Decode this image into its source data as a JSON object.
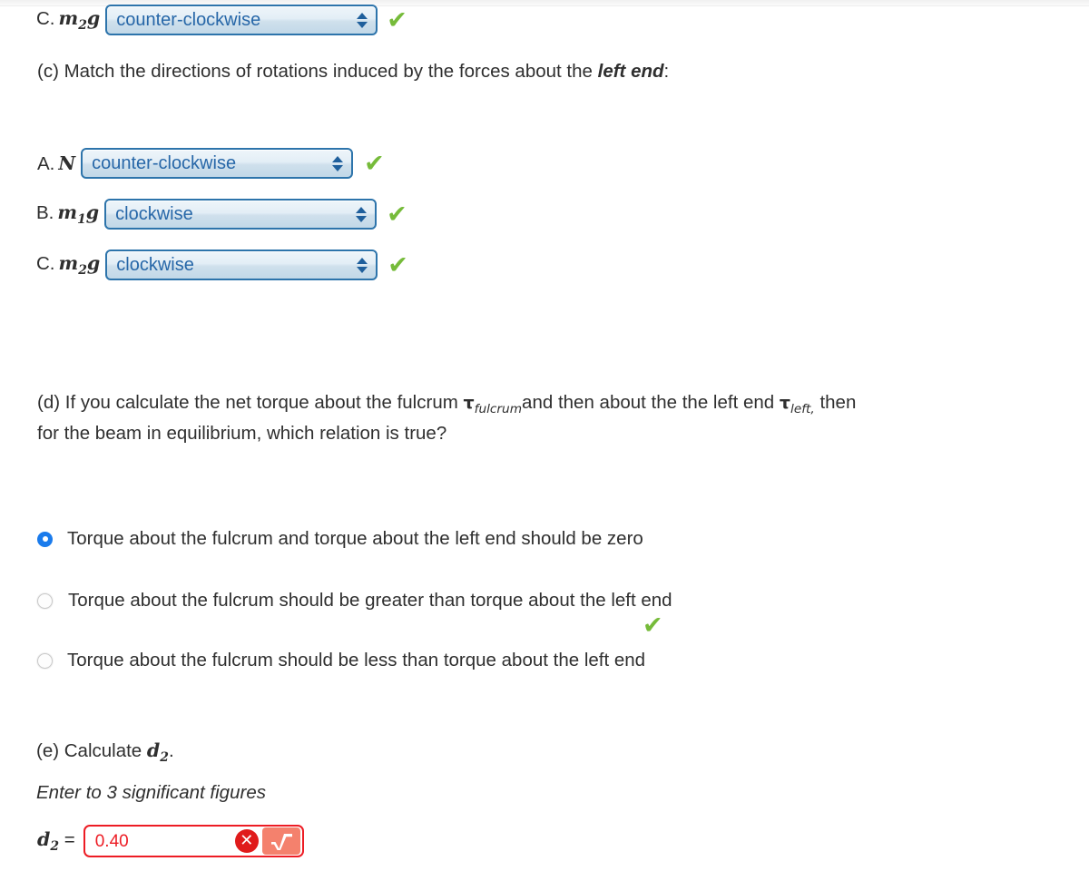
{
  "sections": {
    "part_b_last_row": {
      "label_prefix": "C.",
      "label_var": "m",
      "label_sub": "2",
      "label_suffix": "g",
      "selected": "counter-clockwise",
      "options": [
        "clockwise",
        "counter-clockwise"
      ],
      "status": "correct",
      "check_glyph": "✔"
    },
    "part_c": {
      "prompt_before": "(c) Match the directions of rotations induced by the forces about the ",
      "prompt_bold": "left end",
      "prompt_after": ":",
      "rows": [
        {
          "letter": "A.",
          "var": "N",
          "sub": "",
          "suffix": "",
          "selected": "counter-clockwise",
          "options": [
            "clockwise",
            "counter-clockwise"
          ],
          "status": "correct",
          "check_glyph": "✔"
        },
        {
          "letter": "B.",
          "var": "m",
          "sub": "1",
          "suffix": "g",
          "selected": "clockwise",
          "options": [
            "clockwise",
            "counter-clockwise"
          ],
          "status": "correct",
          "check_glyph": "✔"
        },
        {
          "letter": "C.",
          "var": "m",
          "sub": "2",
          "suffix": "g",
          "selected": "clockwise",
          "options": [
            "clockwise",
            "counter-clockwise"
          ],
          "status": "correct",
          "check_glyph": "✔"
        }
      ]
    },
    "part_d": {
      "line1_a": "(d) If you calculate the net torque about the fulcrum ",
      "tau1_symbol": "τ",
      "tau1_sub": "fulcrum",
      "line1_b": "and then about the the left end ",
      "tau2_symbol": "τ",
      "tau2_sub": "left,",
      "line1_c": " then",
      "line2": "for the beam in equilibrium, which relation is true?",
      "options": [
        {
          "label": "Torque about the fulcrum and torque about the left end should be zero",
          "selected": true
        },
        {
          "label": "Torque about the fulcrum should be greater than torque about the left end",
          "selected": false
        },
        {
          "label": "Torque about the fulcrum should be less than torque about the left end",
          "selected": false
        }
      ],
      "feedback_check_glyph": "✔",
      "feedback_status": "correct"
    },
    "part_e": {
      "prompt_prefix": "(e) Calculate ",
      "prompt_var": "d",
      "prompt_sub": "2",
      "prompt_suffix": ".",
      "hint": "Enter to 3 significant figures",
      "answer_var": "d",
      "answer_sub": "2",
      "answer_eq": "=",
      "answer_value": "0.40",
      "answer_placeholder": "",
      "status": "incorrect",
      "x_glyph": "✕",
      "sqrt_label": "√"
    }
  },
  "colors": {
    "correct_green": "#76bb3a",
    "incorrect_red": "#ed1c24",
    "select_blue": "#2767a8",
    "select_border": "#2d74ab",
    "radio_selected": "#1a7bec",
    "sqrt_button": "#f4816d",
    "text": "#2f2f2f"
  }
}
